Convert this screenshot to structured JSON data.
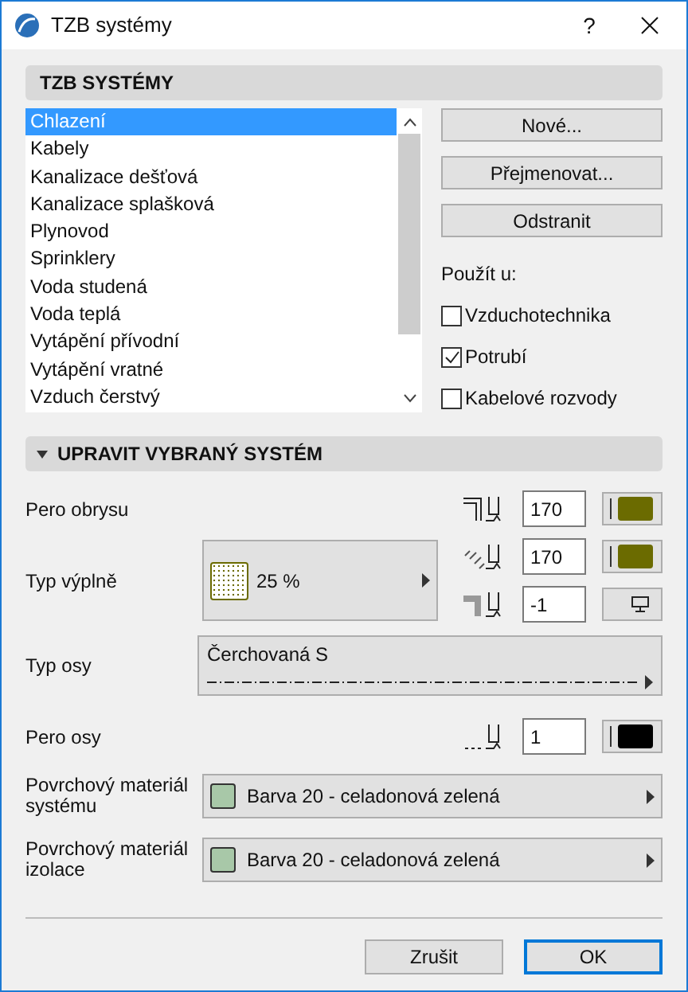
{
  "window": {
    "title": "TZB systémy",
    "help": "?"
  },
  "systems_section": {
    "title": "TZB SYSTÉMY",
    "items": [
      {
        "label": "Chlazení",
        "selected": true
      },
      {
        "label": "Kabely",
        "selected": false
      },
      {
        "label": "Kanalizace dešťová",
        "selected": false
      },
      {
        "label": "Kanalizace splašková",
        "selected": false
      },
      {
        "label": "Plynovod",
        "selected": false
      },
      {
        "label": "Sprinklery",
        "selected": false
      },
      {
        "label": "Voda studená",
        "selected": false
      },
      {
        "label": "Voda teplá",
        "selected": false
      },
      {
        "label": "Vytápění přívodní",
        "selected": false
      },
      {
        "label": "Vytápění vratné",
        "selected": false
      },
      {
        "label": "Vzduch čerstvý",
        "selected": false
      }
    ],
    "buttons": [
      "Nové...",
      "Přejmenovat...",
      "Odstranit"
    ],
    "apply_label": "Použít u:",
    "apply_options": [
      {
        "label": "Vzduchotechnika",
        "checked": false
      },
      {
        "label": "Potrubí",
        "checked": true
      },
      {
        "label": "Kabelové rozvody",
        "checked": false
      }
    ]
  },
  "edit_section": {
    "title": "UPRAVIT VYBRANÝ SYSTÉM",
    "expanded": true,
    "contour_pen": {
      "label": "Pero obrysu",
      "value": "170",
      "kind": "color",
      "color": "#6b6b00"
    },
    "fill_type": {
      "label": "Typ výplně",
      "value": "25 %",
      "pens": [
        {
          "kind": "color",
          "value": "170",
          "color": "#6b6b00"
        },
        {
          "kind": "screen",
          "value": "-1"
        }
      ]
    },
    "axis_type": {
      "label": "Typ osy",
      "value": "Čerchovaná S"
    },
    "axis_pen": {
      "label": "Pero osy",
      "value": "1",
      "kind": "color",
      "color": "#000000"
    },
    "materials": [
      {
        "label": "Povrchový materiál systému",
        "value": "Barva 20 - celadonová zelená",
        "color": "#a8c8a8"
      },
      {
        "label": "Povrchový materiál izolace",
        "value": "Barva 20 - celadonová zelená",
        "color": "#a8c8a8"
      }
    ]
  },
  "footer": {
    "buttons": [
      {
        "label": "Zrušit",
        "default": false
      },
      {
        "label": "OK",
        "default": true
      }
    ]
  }
}
